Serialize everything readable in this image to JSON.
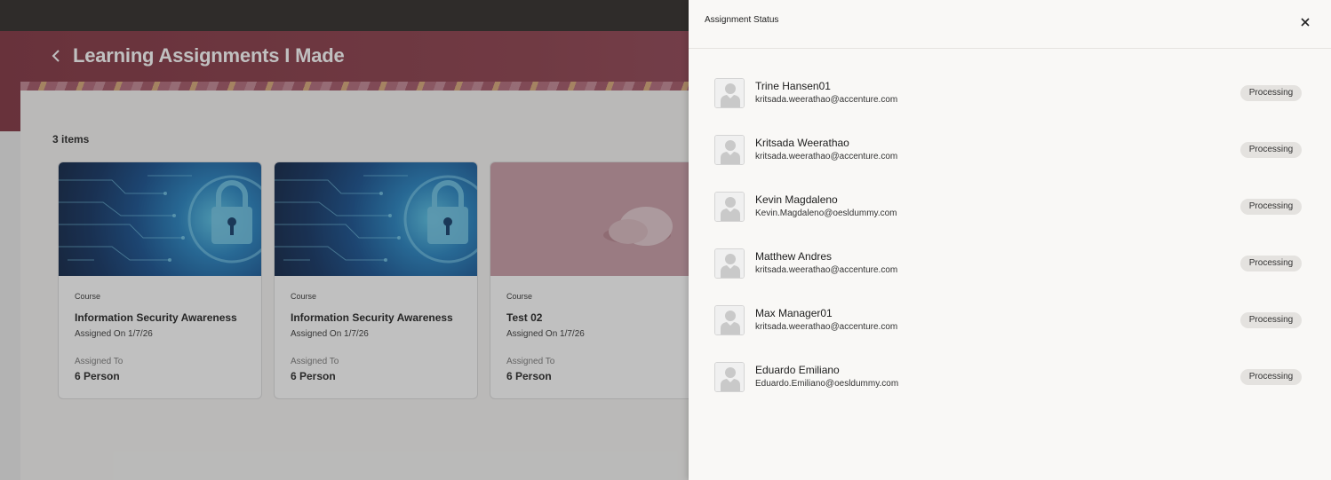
{
  "page": {
    "title": "Learning Assignments I Made",
    "item_count": "3 items"
  },
  "cards": [
    {
      "type": "Course",
      "title": "Information Security Awareness",
      "assigned_on": "Assigned On 1/7/26",
      "assigned_to_label": "Assigned To",
      "assigned_to_value": "6 Person"
    },
    {
      "type": "Course",
      "title": "Information Security Awareness",
      "assigned_on": "Assigned On 1/7/26",
      "assigned_to_label": "Assigned To",
      "assigned_to_value": "6 Person"
    },
    {
      "type": "Course",
      "title": "Test 02",
      "assigned_on": "Assigned On 1/7/26",
      "assigned_to_label": "Assigned To",
      "assigned_to_value": "6 Person"
    }
  ],
  "drawer": {
    "title": "Assignment Status",
    "people": [
      {
        "name": "Trine Hansen01",
        "email": "kritsada.weerathao@accenture.com",
        "status": "Processing"
      },
      {
        "name": "Kritsada Weerathao",
        "email": "kritsada.weerathao@accenture.com",
        "status": "Processing"
      },
      {
        "name": "Kevin Magdaleno",
        "email": "Kevin.Magdaleno@oesldummy.com",
        "status": "Processing"
      },
      {
        "name": "Matthew Andres",
        "email": "kritsada.weerathao@accenture.com",
        "status": "Processing"
      },
      {
        "name": "Max Manager01",
        "email": "kritsada.weerathao@accenture.com",
        "status": "Processing"
      },
      {
        "name": "Eduardo Emiliano",
        "email": "Eduardo.Emiliano@oesldummy.com",
        "status": "Processing"
      }
    ]
  },
  "colors": {
    "hero": "#7e2f3c",
    "topbar": "#2a2522",
    "status_pill": "#e4e2df"
  }
}
